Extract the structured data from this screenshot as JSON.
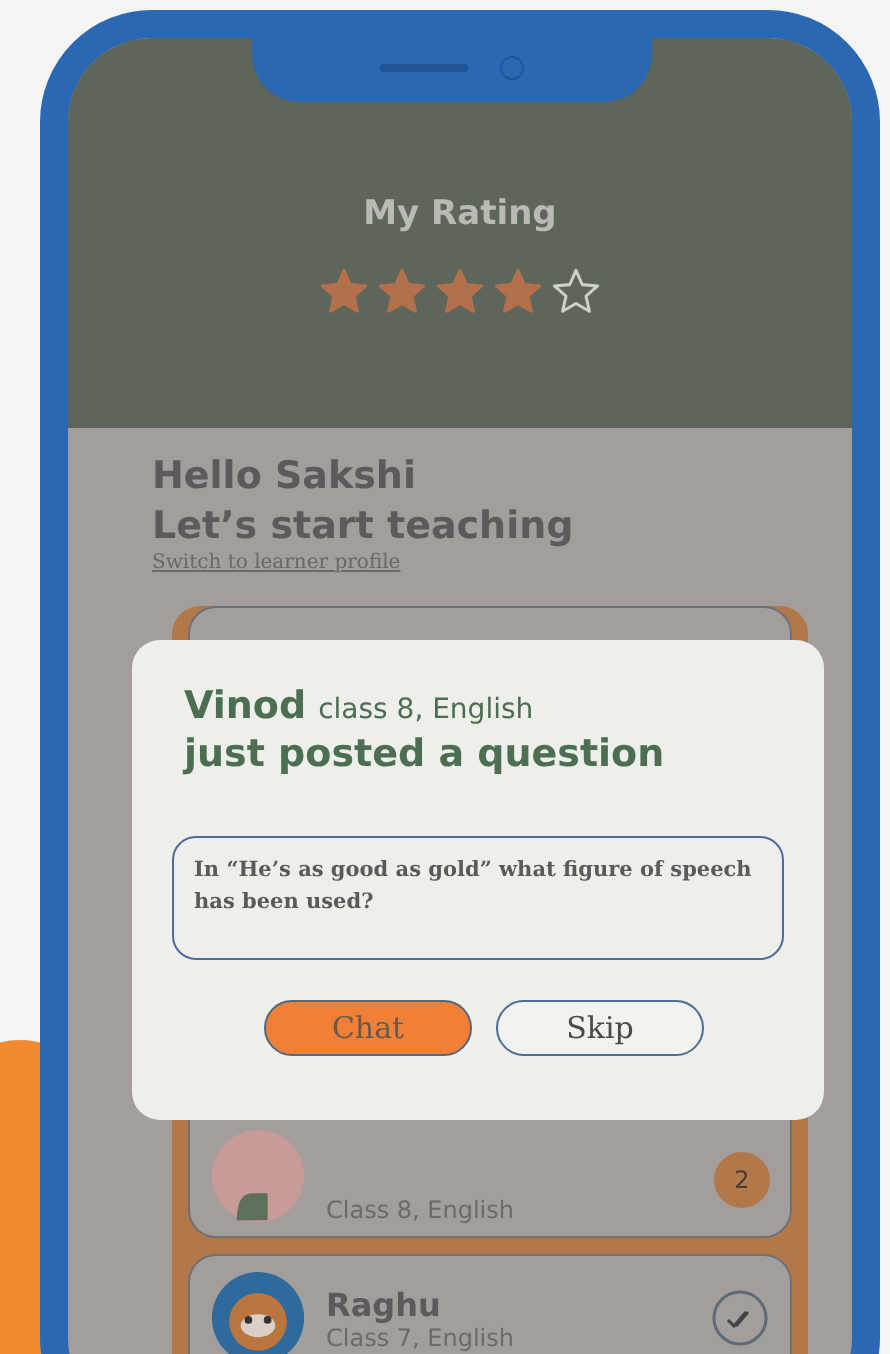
{
  "rating": {
    "title": "My Rating",
    "stars": 4
  },
  "greeting": {
    "line_1": "Hello Sakshi",
    "line_2": "Let’s start teaching",
    "link": "Switch to learner profile"
  },
  "dialog": {
    "name": "Vinod",
    "detail": "class 8, English",
    "message": "just posted a question",
    "question": "In “He’s as good as gold” what figure of speech has been used?",
    "buttons": [
      {
        "label": "Chat",
        "kind": "primary"
      },
      {
        "label": "Skip",
        "kind": "secondary"
      }
    ]
  },
  "students": [
    {
      "kind": "count",
      "detail": "Class 8, English",
      "badge": "2"
    },
    {
      "kind": "read",
      "name": "Raghu",
      "detail": "Class 7, English"
    }
  ]
}
